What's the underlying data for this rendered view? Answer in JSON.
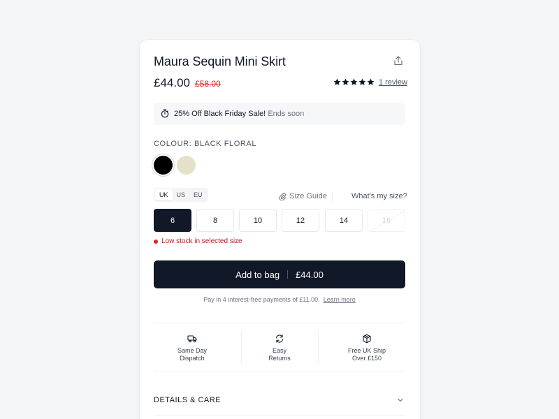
{
  "product": {
    "title": "Maura Sequin Mini Skirt",
    "price": "£44.00",
    "old_price": "£58.00",
    "rating": 5,
    "review_link": "1 review"
  },
  "promo": {
    "headline": "25% Off Black Friday Sale!",
    "subtext": "Ends soon"
  },
  "colour": {
    "label": "COLOUR: BLACK FLORAL",
    "swatches": [
      "#000000",
      "#e5e0c9"
    ],
    "selected_index": 0
  },
  "sizes": {
    "units": [
      "UK",
      "US",
      "EU"
    ],
    "active_unit": "UK",
    "size_guide_label": "Size Guide",
    "whats_my_size_label": "What's my size?",
    "options": [
      "6",
      "8",
      "10",
      "12",
      "14",
      "16"
    ],
    "selected": "6",
    "unavailable": [
      "16"
    ],
    "stock_message": "Low stock in selected size"
  },
  "cta": {
    "label": "Add to bag",
    "price": "£44.00"
  },
  "payment_note": {
    "text": "Pay in 4 interest-free payments of £11.00.",
    "link": "Learn more"
  },
  "perks": [
    {
      "icon": "truck-icon",
      "line1": "Same Day",
      "line2": "Dispatch"
    },
    {
      "icon": "refresh-icon",
      "line1": "Easy",
      "line2": "Returns"
    },
    {
      "icon": "box-icon",
      "line1": "Free UK Ship",
      "line2": "Over £150"
    }
  ],
  "accordion": {
    "details_label": "DETAILS & CARE"
  },
  "colors": {
    "primary": "#111827",
    "sale_red": "#dc2626",
    "page_bg": "#f4f5f7"
  }
}
